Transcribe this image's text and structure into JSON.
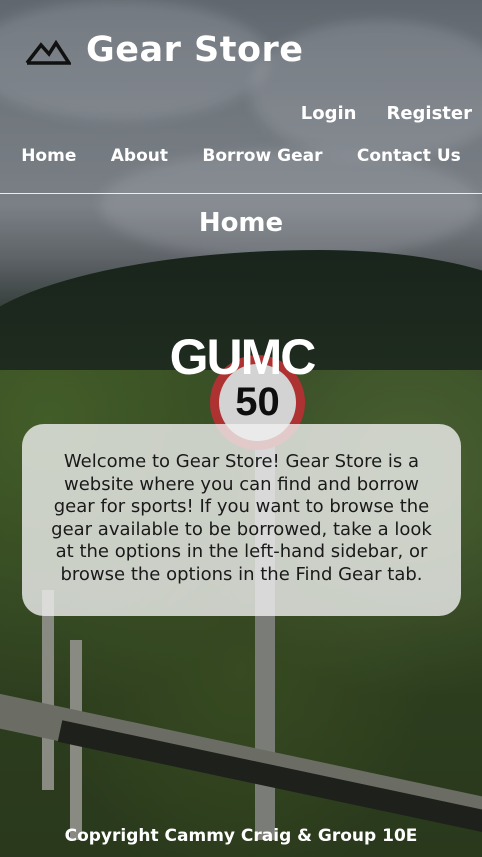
{
  "header": {
    "title": "Gear Store",
    "logo_icon": "mountain-icon",
    "auth_links": [
      "Login",
      "Register"
    ],
    "nav": [
      "Home",
      "About",
      "Borrow Gear",
      "Contact Us"
    ]
  },
  "main": {
    "page_title": "Home",
    "brand_text": "GUMC",
    "intro": "Welcome to Gear Store! Gear Store is a website where you can find and borrow gear for sports! If you want to browse the gear available to be borrowed, take a look at the options in the left-hand sidebar, or browse the options in the Find Gear tab."
  },
  "background": {
    "sign_text": "50"
  },
  "footer": {
    "copyright": "Copyright Cammy Craig & Group 10E"
  }
}
